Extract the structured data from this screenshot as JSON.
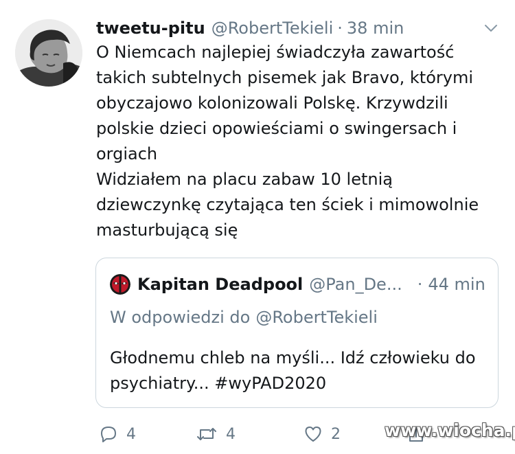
{
  "tweet": {
    "display_name": "tweetu-pitu",
    "handle": "@RobertTekieli",
    "separator": "·",
    "time": "38 min",
    "text_lines": [
      "O Niemcach najlepiej świadczyła zawartość takich subtelnych pisemek jak Bravo, którymi obyczajowo kolonizowali Polskę. Krzywdzili polskie dzieci opowieściami o swingersach i orgiach",
      "Widziałem na placu zabaw 10 letnią dziewczynkę czytająca ten ściek i mimowolnie masturbującą się"
    ],
    "menu_icon": "chevron-down-icon"
  },
  "quote": {
    "display_name": "Kapitan Deadpool",
    "handle": "@Pan_De...",
    "separator": "·",
    "time": "44 min",
    "reply_prefix": "W odpowiedzi do",
    "reply_to": "@RobertTekieli",
    "text": "Głodnemu chleb na myśli... Idź człowieku do psychiatry... #wyPAD2020",
    "avatar_icon": "deadpool-mask-icon"
  },
  "actions": {
    "reply_count": "4",
    "retweet_count": "4",
    "like_count": "2",
    "reply_icon": "reply-icon",
    "retweet_icon": "retweet-icon",
    "like_icon": "heart-icon",
    "share_icon": "share-icon"
  },
  "watermark": {
    "text": "www.wiocha.pl"
  },
  "colors": {
    "text": "#14171a",
    "secondary": "#657786",
    "border": "#ccd6dd",
    "background": "#ffffff"
  }
}
